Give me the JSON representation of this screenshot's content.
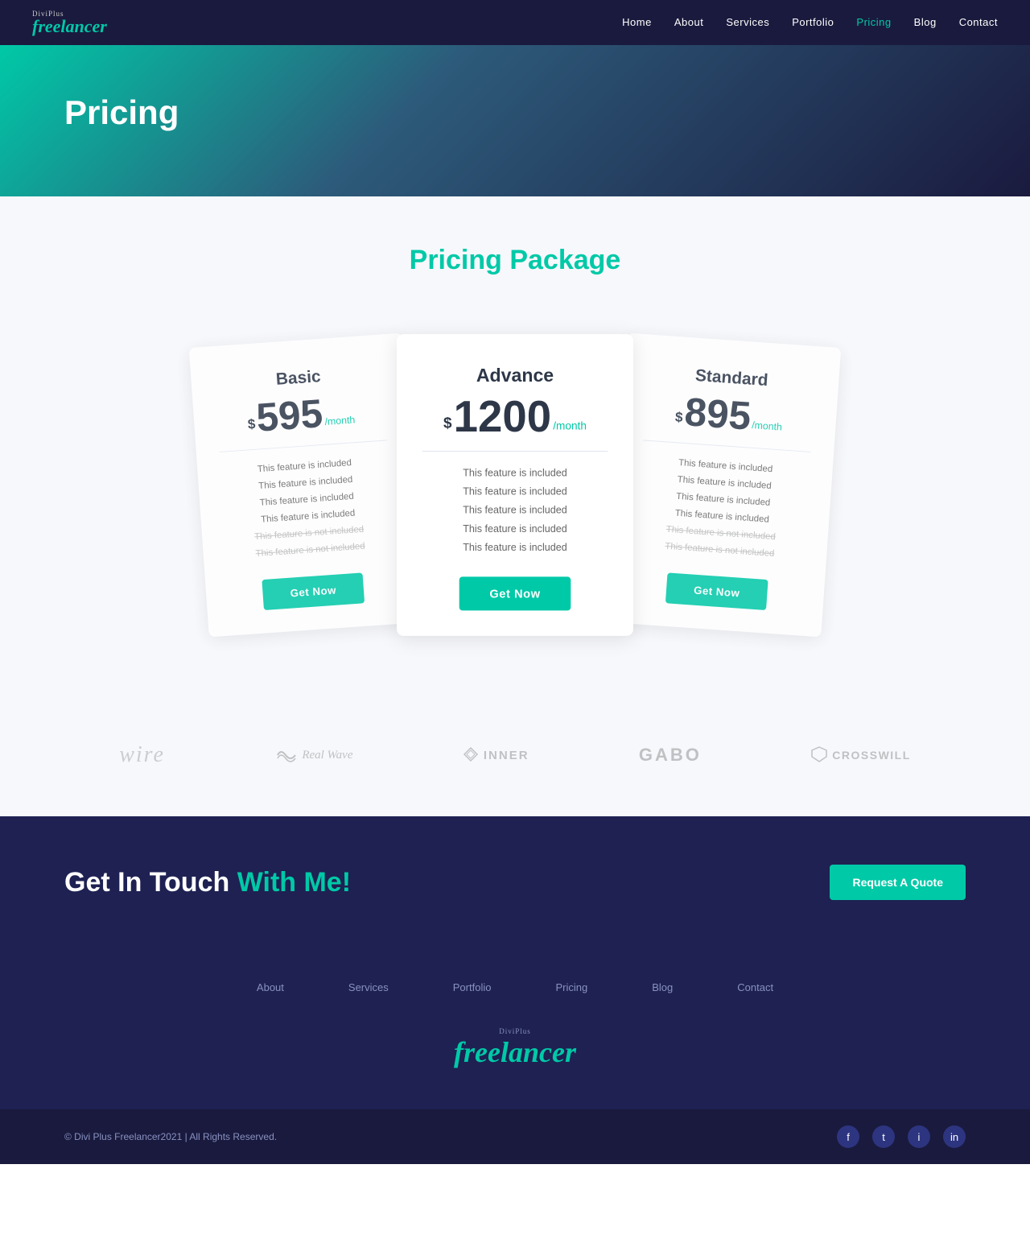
{
  "nav": {
    "logo": {
      "diviplus": "DiviPlus",
      "freelancer": "freelancer"
    },
    "links": [
      {
        "label": "Home",
        "active": false
      },
      {
        "label": "About",
        "active": false
      },
      {
        "label": "Services",
        "active": false
      },
      {
        "label": "Portfolio",
        "active": false
      },
      {
        "label": "Pricing",
        "active": true
      },
      {
        "label": "Blog",
        "active": false
      },
      {
        "label": "Contact",
        "active": false
      }
    ]
  },
  "hero": {
    "title": "Pricing"
  },
  "pricing": {
    "section_title_part1": "Pricing ",
    "section_title_part2": "Package",
    "cards": [
      {
        "id": "basic",
        "name": "Basic",
        "currency": "$",
        "amount": "595",
        "period": "/month",
        "features": [
          {
            "text": "This feature is included",
            "included": true
          },
          {
            "text": "This feature is included",
            "included": true
          },
          {
            "text": "This feature is included",
            "included": true
          },
          {
            "text": "This feature is included",
            "included": true
          },
          {
            "text": "This feature is not included",
            "included": false
          },
          {
            "text": "This feature is not included",
            "included": false
          }
        ],
        "button": "Get Now",
        "position": "left"
      },
      {
        "id": "advance",
        "name": "Advance",
        "currency": "$",
        "amount": "1200",
        "period": "/month",
        "features": [
          {
            "text": "This feature is included",
            "included": true
          },
          {
            "text": "This feature is included",
            "included": true
          },
          {
            "text": "This feature is included",
            "included": true
          },
          {
            "text": "This feature is included",
            "included": true
          },
          {
            "text": "This feature is included",
            "included": true
          }
        ],
        "button": "Get Now",
        "position": "center"
      },
      {
        "id": "standard",
        "name": "Standard",
        "currency": "$",
        "amount": "895",
        "period": "/month",
        "features": [
          {
            "text": "included",
            "included": true
          },
          {
            "text": "This feature is included",
            "included": true
          },
          {
            "text": "This feature is included",
            "included": true
          },
          {
            "text": "This feature is included",
            "included": true
          },
          {
            "text": "This feature is not included",
            "included": false
          },
          {
            "text": "This feature is not included",
            "included": false
          }
        ],
        "button": "Get Now",
        "position": "right"
      }
    ]
  },
  "logos": [
    {
      "name": "wire",
      "text": "wire",
      "type": "wire"
    },
    {
      "name": "realwave",
      "text": "Real Wave",
      "type": "realwave"
    },
    {
      "name": "inner",
      "text": "INNER",
      "type": "inner"
    },
    {
      "name": "gabo",
      "text": "GABO",
      "type": "gabo"
    },
    {
      "name": "crosswill",
      "text": "CROSSWILL",
      "type": "crosswill"
    }
  ],
  "cta": {
    "heading_part1": "Get In Touch ",
    "heading_part2": "With ",
    "heading_part3": "Me!",
    "button_label": "Request A Quote"
  },
  "footer": {
    "nav_links": [
      "About",
      "Services",
      "Portfolio",
      "Pricing",
      "Blog",
      "Contact"
    ],
    "logo": {
      "diviplus": "DiviPlus",
      "freelancer": "freelancer"
    },
    "copyright": "© Divi Plus Freelancer2021  |  All Rights Reserved.",
    "social": [
      "f",
      "t",
      "i",
      "in"
    ]
  }
}
